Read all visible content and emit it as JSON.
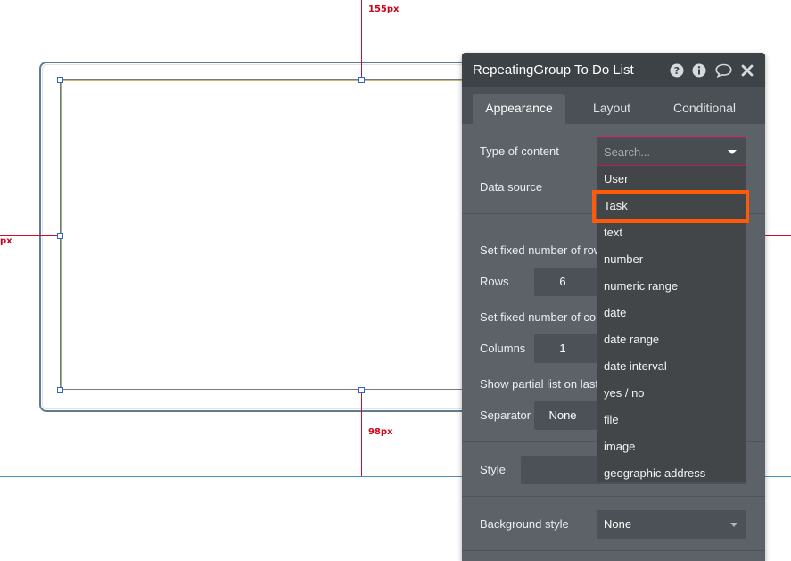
{
  "canvas": {
    "top_distance_label": "155px",
    "left_distance_label": "px",
    "bottom_distance_label": "98px"
  },
  "panel": {
    "title": "RepeatingGroup To Do List",
    "header_icons": [
      "help-icon",
      "info-icon",
      "comment-icon",
      "close-icon"
    ],
    "tabs": [
      {
        "label": "Appearance",
        "active": true
      },
      {
        "label": "Layout",
        "active": false
      },
      {
        "label": "Conditional",
        "active": false
      }
    ],
    "type_of_content_label": "Type of content",
    "type_of_content_placeholder": "Search...",
    "data_source_label": "Data source",
    "fixed_rows_label": "Set fixed number of rows",
    "rows_label": "Rows",
    "rows_value": "6",
    "fixed_columns_label": "Set fixed number of columns",
    "columns_label": "Columns",
    "columns_value": "1",
    "partial_list_label": "Show partial list on last",
    "separator_label": "Separator",
    "separator_value": "None",
    "style_label": "Style",
    "background_style_label": "Background style",
    "background_style_value": "None"
  },
  "dropdown": {
    "options": [
      "User",
      "Task",
      "text",
      "number",
      "numeric range",
      "date",
      "date range",
      "date interval",
      "yes / no",
      "file",
      "image",
      "geographic address"
    ],
    "highlighted": "Task"
  },
  "colors": {
    "panel_bg": "#5c6268",
    "panel_header_bg": "#3c4246",
    "dropdown_bg": "#434648",
    "highlight_border": "#ff5a0a",
    "guide_red": "#d0021b",
    "page_line": "#4a90c2"
  }
}
